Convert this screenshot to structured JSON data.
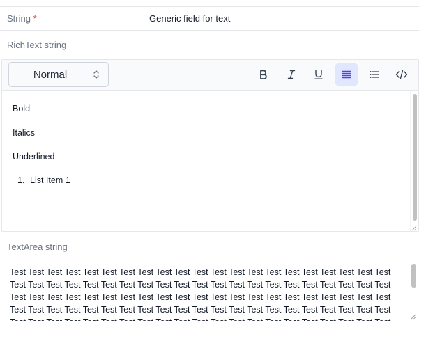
{
  "string_field": {
    "label": "String",
    "required_mark": "*",
    "value": "Generic field for text"
  },
  "richtext_field": {
    "label": "RichText string",
    "toolbar": {
      "heading_select": "Normal",
      "buttons": [
        "bold-icon",
        "italic-icon",
        "underline-icon",
        "align-justify-icon",
        "bullet-list-icon",
        "code-icon"
      ],
      "active_button": "align-justify-icon"
    },
    "content": {
      "bold": "Bold",
      "italics": "Italics",
      "underlined": "Underlined",
      "list_number": "1.",
      "list_item": "List Item 1"
    }
  },
  "textarea_field": {
    "label": "TextArea string",
    "value": "Test Test Test Test Test Test Test Test Test Test Test Test Test Test Test Test Test Test Test Test Test Test Test Test Test Test Test Test Test Test Test Test Test Test Test Test Test Test Test Test Test Test Test Test Test Test Test Test Test Test Test Test Test Test Test Test Test Test Test Test Test Test Test Test Test Test Test Test Test Test Test Test Test Test Test Test Test Test Test Test Test Test Test Test Test Test Test Test Test Test Test Test Test Test Test Test Test Test Test Test Test Test Test Test Test Test Test Test Test Test Test Test Test Test"
  },
  "colors": {
    "accent": "#4f46e5",
    "active_bg": "#e0e7ff",
    "required": "#dc2626",
    "label": "#6b7280"
  }
}
